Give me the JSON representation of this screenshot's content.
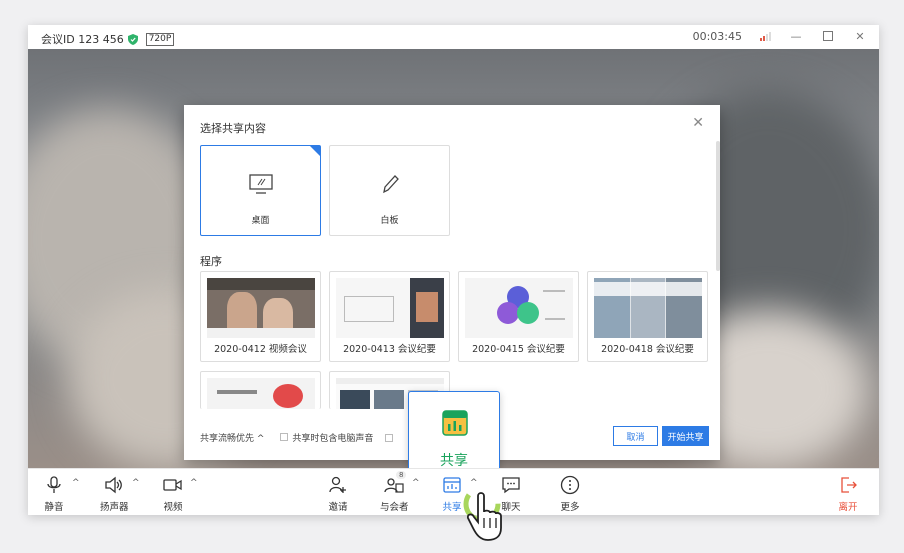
{
  "titlebar": {
    "meeting_id": "会议ID 123 456",
    "resolution": "720P",
    "timer": "00:03:45"
  },
  "dialog": {
    "title": "选择共享内容",
    "options": [
      {
        "label": "桌面",
        "icon": "desktop-icon",
        "selected": true
      },
      {
        "label": "白板",
        "icon": "pen-icon",
        "selected": false
      }
    ],
    "programs_title": "程序",
    "programs": [
      {
        "label": "2020-0412 视频会议"
      },
      {
        "label": "2020-0413 会议纪要"
      },
      {
        "label": "2020-0415 会议纪要"
      },
      {
        "label": "2020-0418 会议纪要"
      }
    ],
    "footer": {
      "fluency": "共享流畅优先 ^",
      "include_audio": "共享时包含电脑声音"
    },
    "cancel": "取消",
    "start": "开始共享"
  },
  "popup": {
    "label": "共享"
  },
  "toolbar": {
    "mute": "静音",
    "speaker": "扬声器",
    "video": "视频",
    "invite": "邀请",
    "participants": "与会者",
    "participants_count": "8",
    "share": "共享",
    "chat": "聊天",
    "more": "更多",
    "leave": "离开"
  },
  "colors": {
    "accent": "#2d7be5",
    "share_green": "#1aa35c",
    "leave_red": "#e8503a"
  }
}
